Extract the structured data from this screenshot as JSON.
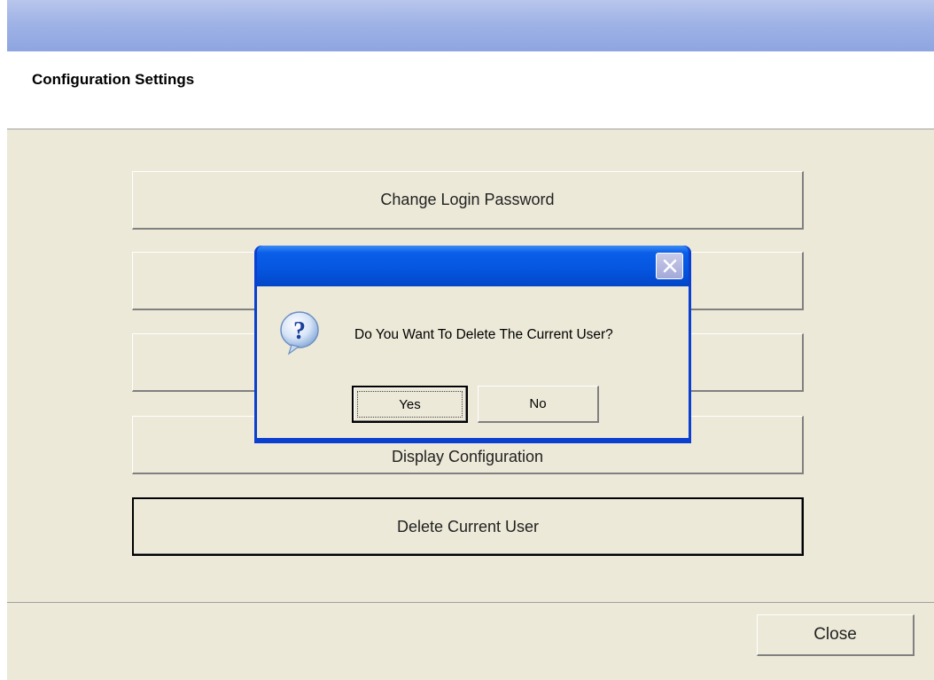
{
  "window": {
    "header_title": "Configuration Settings"
  },
  "options": {
    "change_password": "Change Login Password",
    "hidden_option_1": "",
    "hidden_option_2": "",
    "display_configuration": "Display Configuration",
    "delete_current_user": "Delete Current User"
  },
  "footer": {
    "close_label": "Close"
  },
  "dialog": {
    "icon": "question-icon",
    "message": "Do You Want To Delete The Current User?",
    "yes_label": "Yes",
    "no_label": "No",
    "close_icon": "close-icon"
  },
  "colors": {
    "dialog_frame": "#0a3fd0",
    "window_background": "#ece9d8",
    "titlebar": "#9fb3e6"
  }
}
